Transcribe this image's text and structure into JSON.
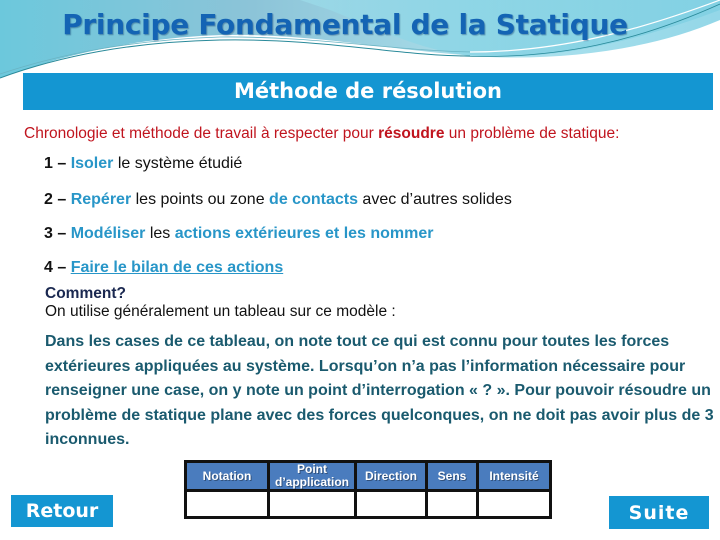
{
  "header": {
    "title": "Principe Fondamental de la Statique",
    "subtitle": "Méthode de résolution"
  },
  "intro": {
    "before": "Chronologie et méthode de travail à respecter pour ",
    "emphasis": "résoudre",
    "after": " un problème de statique:"
  },
  "steps": [
    {
      "num": "1 – ",
      "parts": [
        {
          "text": "Isoler",
          "hl": true
        },
        {
          "text": " le système étudié",
          "hl": false
        }
      ]
    },
    {
      "num": "2 – ",
      "parts": [
        {
          "text": "Repérer",
          "hl": true
        },
        {
          "text": " les points ou zone ",
          "hl": false
        },
        {
          "text": "de contacts",
          "hl": true
        },
        {
          "text": " avec d’autres solides",
          "hl": false
        }
      ]
    },
    {
      "num": "3 – ",
      "parts": [
        {
          "text": "Modéliser",
          "hl": true
        },
        {
          "text": " les ",
          "hl": false
        },
        {
          "text": "actions extérieures et les nommer",
          "hl": true
        }
      ]
    },
    {
      "num": "4 – ",
      "parts": [
        {
          "text": "Faire le bilan de ces actions",
          "hl": true,
          "underline": true
        }
      ]
    }
  ],
  "comment_label": "Comment?",
  "usage_text": "On utilise généralement un tableau sur ce modèle :",
  "paragraph": "Dans les cases de ce tableau, on note tout ce qui est connu pour toutes les forces extérieures appliquées au système. Lorsqu’on n’a pas l’information nécessaire pour renseigner une case, on y note un point d’interrogation « ? ». Pour pouvoir résoudre un problème de statique plane avec des forces quelconques, on ne doit pas avoir plus de 3 inconnues.",
  "table": {
    "headers": [
      "Notation",
      "Point d’application",
      "Direction",
      "Sens",
      "Intensité"
    ],
    "rows": [
      [
        "",
        "",
        "",
        "",
        ""
      ]
    ]
  },
  "nav": {
    "back_label": "Retour",
    "next_label": "Suite"
  },
  "colors": {
    "title": "#1464b4",
    "band": "#1496d2",
    "intro": "#c0141e",
    "highlight": "#2896c8",
    "paragraph": "#1a5a6e",
    "table_header": "#4a7cbe"
  }
}
